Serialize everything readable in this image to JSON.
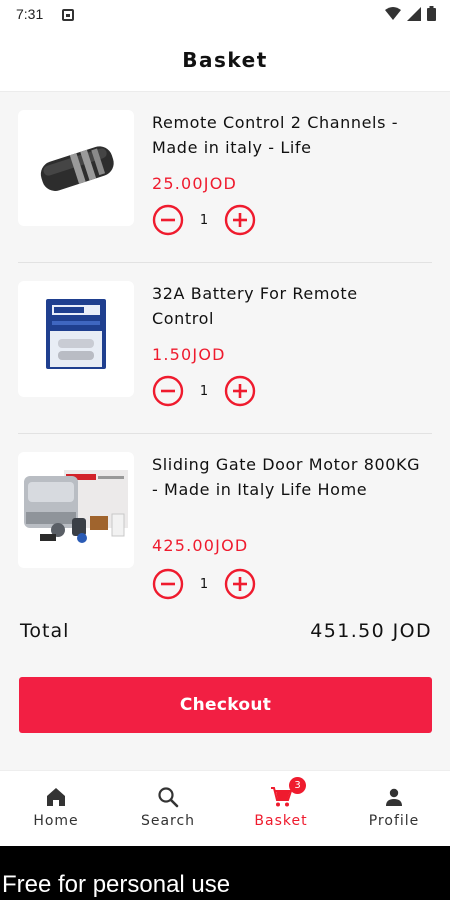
{
  "status_bar": {
    "time": "7:31"
  },
  "header": {
    "title": "Basket"
  },
  "items": [
    {
      "name": "Remote Control 2 Channels - Made in italy - Life",
      "price": "25.00JOD",
      "quantity": "1",
      "thumb_icon": "remote-control-image"
    },
    {
      "name": "32A Battery For Remote Control",
      "price": "1.50JOD",
      "quantity": "1",
      "thumb_icon": "battery-pack-image"
    },
    {
      "name": "Sliding Gate Door Motor 800KG - Made in Italy Life Home",
      "price": "425.00JOD",
      "quantity": "1",
      "thumb_icon": "gate-motor-kit-image"
    }
  ],
  "totals": {
    "label": "Total",
    "value": "451.50 JOD"
  },
  "checkout": {
    "label": "Checkout"
  },
  "nav": {
    "items": [
      {
        "label": "Home",
        "icon": "home-icon"
      },
      {
        "label": "Search",
        "icon": "search-icon"
      },
      {
        "label": "Basket",
        "icon": "cart-icon",
        "badge": "3",
        "active": true
      },
      {
        "label": "Profile",
        "icon": "person-icon"
      }
    ]
  },
  "watermark": {
    "text": "Free for personal use"
  },
  "colors": {
    "accent": "#ef1b2e",
    "checkout_bg": "#f21f43",
    "list_bg": "#f6f6f6"
  }
}
